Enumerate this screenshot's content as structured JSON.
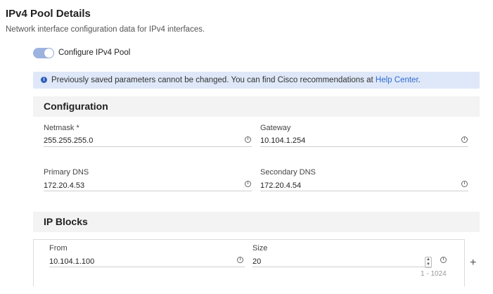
{
  "header": {
    "title": "IPv4 Pool Details",
    "subtitle": "Network interface configuration data for IPv4 interfaces."
  },
  "toggle": {
    "label": "Configure IPv4 Pool",
    "checked": true
  },
  "banner": {
    "text": "Previously saved parameters cannot be changed. You can find Cisco recommendations at ",
    "link": "Help Center",
    "suffix": "."
  },
  "configuration": {
    "title": "Configuration",
    "netmask": {
      "label": "Netmask *",
      "value": "255.255.255.0"
    },
    "gateway": {
      "label": "Gateway",
      "value": "10.104.1.254"
    },
    "primary_dns": {
      "label": "Primary DNS",
      "value": "172.20.4.53"
    },
    "secondary_dns": {
      "label": "Secondary DNS",
      "value": "172.20.4.54"
    }
  },
  "ip_blocks": {
    "title": "IP Blocks",
    "from": {
      "label": "From",
      "value": "10.104.1.100"
    },
    "size": {
      "label": "Size",
      "value": "20",
      "range": "1 - 1024"
    }
  },
  "colors": {
    "accent": "#2f6bd0",
    "banner_bg": "#dfe8f8",
    "toggle_on": "#9cb3e0"
  }
}
